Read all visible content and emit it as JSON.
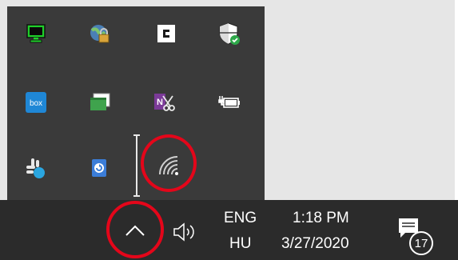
{
  "tray": {
    "icons": [
      {
        "name": "monitor-icon"
      },
      {
        "name": "network-lock-icon"
      },
      {
        "name": "c-app-icon"
      },
      {
        "name": "security-shield-icon"
      },
      {
        "name": "box-icon",
        "label": "box"
      },
      {
        "name": "window-sync-icon"
      },
      {
        "name": "onenote-clipper-icon",
        "label": "N"
      },
      {
        "name": "battery-plug-icon"
      },
      {
        "name": "slack-icon"
      },
      {
        "name": "remote-sync-icon"
      },
      {
        "name": "wifi-icon"
      }
    ]
  },
  "taskbar": {
    "chevron": "^",
    "language_top": "ENG",
    "language_bottom": "HU",
    "time": "1:18 PM",
    "date": "3/27/2020",
    "notification_count": "17"
  },
  "colors": {
    "flyout_bg": "#3a3a3a",
    "taskbar_bg": "#2b2b2b",
    "highlight_ring": "#e4061a",
    "accent_green": "#2ecc40"
  }
}
